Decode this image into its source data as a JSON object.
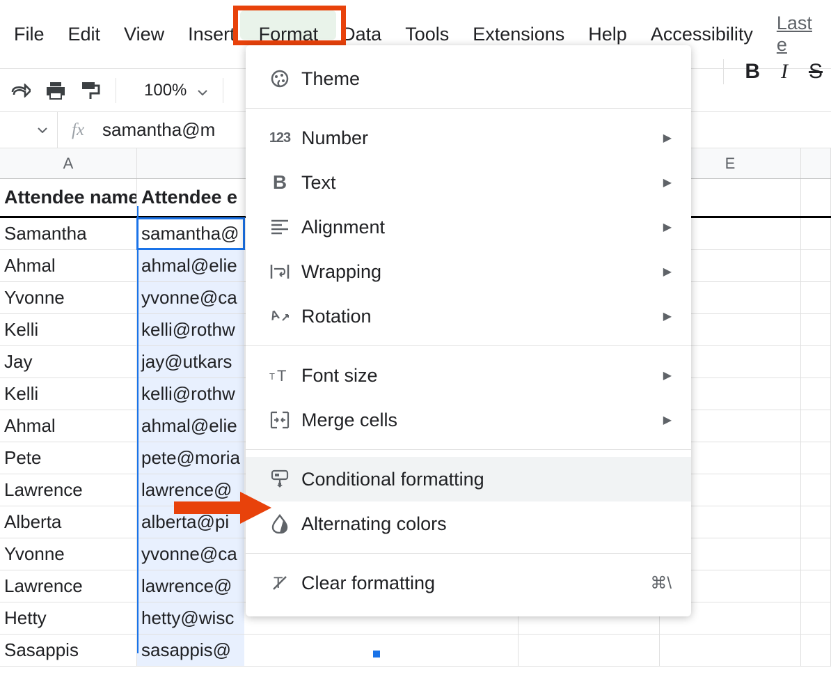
{
  "menubar": {
    "file": "File",
    "edit": "Edit",
    "view": "View",
    "insert": "Insert",
    "format": "Format",
    "data": "Data",
    "tools": "Tools",
    "extensions": "Extensions",
    "help": "Help",
    "accessibility": "Accessibility",
    "last_edit": "Last e"
  },
  "toolbar": {
    "zoom": "100%"
  },
  "formula_bar": {
    "fx": "fx",
    "value": "samantha@m"
  },
  "columns": {
    "A": "A",
    "E": "E"
  },
  "headers": {
    "attendee_name": "Attendee name",
    "attendee_email": "Attendee e"
  },
  "rows": [
    {
      "name": "Samantha",
      "email": "samantha@"
    },
    {
      "name": "Ahmal",
      "email": "ahmal@elie"
    },
    {
      "name": "Yvonne",
      "email": "yvonne@ca"
    },
    {
      "name": "Kelli",
      "email": "kelli@rothw"
    },
    {
      "name": "Jay",
      "email": "jay@utkars"
    },
    {
      "name": "Kelli",
      "email": "kelli@rothw"
    },
    {
      "name": "Ahmal",
      "email": "ahmal@elie"
    },
    {
      "name": "Pete",
      "email": "pete@moria"
    },
    {
      "name": "Lawrence",
      "email": "lawrence@"
    },
    {
      "name": "Alberta",
      "email": "alberta@pi"
    },
    {
      "name": "Yvonne",
      "email": "yvonne@ca"
    },
    {
      "name": "Lawrence",
      "email": "lawrence@"
    },
    {
      "name": "Hetty",
      "email": "hetty@wisc"
    },
    {
      "name": "Sasappis",
      "email": "sasappis@"
    }
  ],
  "dropdown": {
    "theme": "Theme",
    "number": "Number",
    "text": "Text",
    "alignment": "Alignment",
    "wrapping": "Wrapping",
    "rotation": "Rotation",
    "font_size": "Font size",
    "merge_cells": "Merge cells",
    "conditional_formatting": "Conditional formatting",
    "alternating_colors": "Alternating colors",
    "clear_formatting": "Clear formatting",
    "clear_shortcut": "⌘\\"
  }
}
